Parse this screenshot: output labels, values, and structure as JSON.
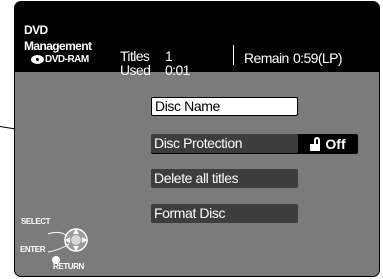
{
  "header": {
    "title_line1": "DVD",
    "title_line2": "Management",
    "media_label": "DVD-RAM",
    "media_icon": "disc-icon"
  },
  "stats": {
    "titles_label": "Titles",
    "titles_value": "1",
    "used_label": "Used",
    "used_value": "0:01",
    "remain_label": "Remain",
    "remain_value": "0:59(LP)"
  },
  "menu": {
    "items": [
      {
        "label": "Disc Name",
        "selected": true
      },
      {
        "label": "Disc Protection"
      },
      {
        "label": "Delete all titles"
      },
      {
        "label": "Format Disc"
      }
    ],
    "protection_state": "Off",
    "protection_icon": "unlock-icon"
  },
  "remote": {
    "select_label": "SELECT",
    "enter_label": "ENTER",
    "return_label": "RETURN"
  },
  "colors": {
    "header_bg": "#000000",
    "panel_bg": "#7b7b7b",
    "item_bg": "#3d3d3d",
    "selected_bg": "#ffffff"
  }
}
